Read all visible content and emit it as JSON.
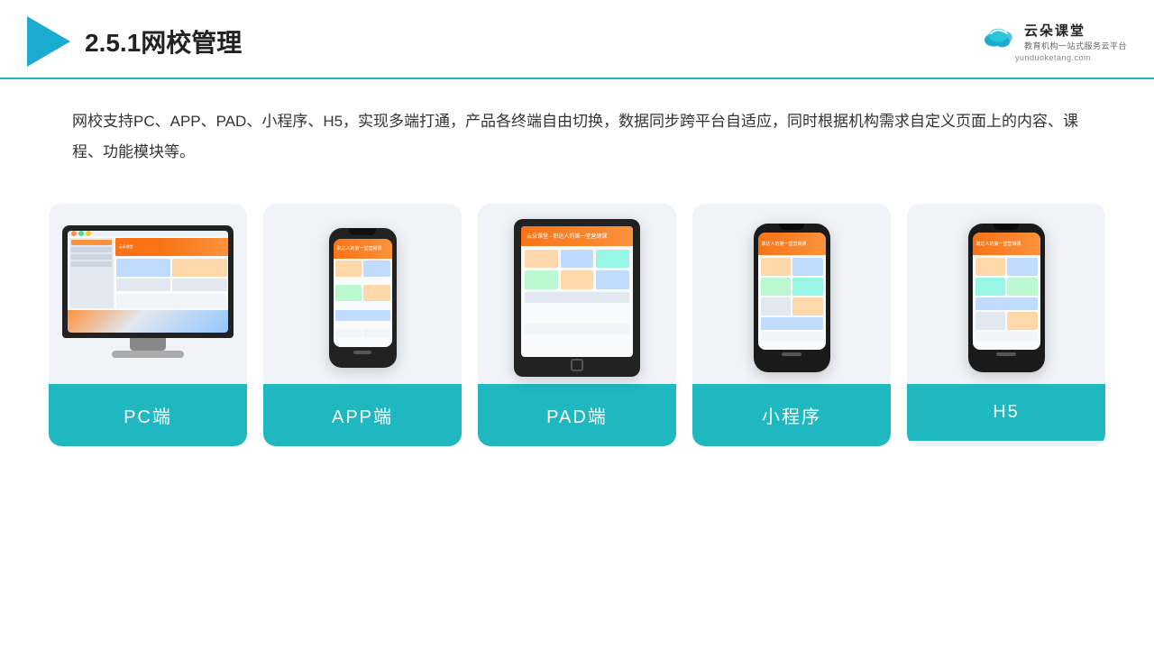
{
  "header": {
    "title": "2.5.1网校管理",
    "brand_name": "云朵课堂",
    "brand_sub": "教育机构一站\n式服务云平台",
    "brand_url": "yunduoketang.com"
  },
  "description": {
    "text": "网校支持PC、APP、PAD、小程序、H5，实现多端打通，产品各终端自由切换，数据同步跨平台自适应，同时根据机构需求自定义页面上的内容、课程、功能模块等。"
  },
  "cards": [
    {
      "id": "pc",
      "label": "PC端"
    },
    {
      "id": "app",
      "label": "APP端"
    },
    {
      "id": "pad",
      "label": "PAD端"
    },
    {
      "id": "miniapp",
      "label": "小程序"
    },
    {
      "id": "h5",
      "label": "H5"
    }
  ]
}
